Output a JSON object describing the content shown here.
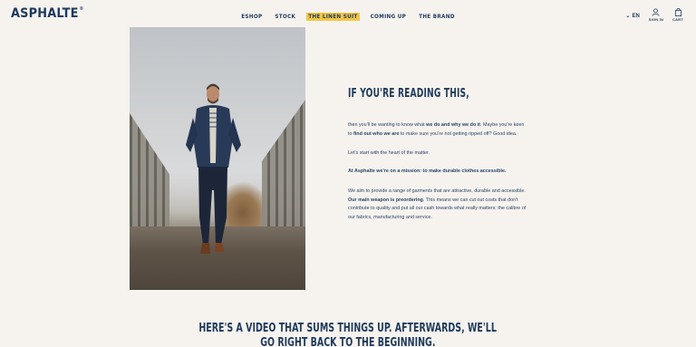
{
  "header": {
    "logo": "ASPHALTE",
    "logo_mark": "®",
    "nav": [
      "ESHOP",
      "STOCK",
      "THE LINEN SUIT",
      "COMING UP",
      "THE BRAND"
    ],
    "highlighted_nav_index": 2,
    "language": "EN",
    "sign_in": "SIGN IN",
    "cart": "CART",
    "accent_color": "#f2c744"
  },
  "main": {
    "heading": "IF YOU'RE READING THIS,",
    "p1_a": "then you'll be wanting to know what ",
    "p1_b": "we do and why we do it",
    "p1_c": ". Maybe you're keen to ",
    "p1_d": "find out who we are",
    "p1_e": " to make sure you're not getting ripped off? Good idea.",
    "p2": "Let's start with the heart of the matter.",
    "p3": "At Asphalte we're on a mission: to make durable clothes accessible.",
    "p4_a": "We aim to provide a range of garments that are attractive, durable and accessible. ",
    "p4_b": "Our main weapon is preordering",
    "p4_c": ". This means we can cut out costs that don't contribute to quality and put all our cash towards what really matters: the calibre of our fabrics, manufacturing and service."
  },
  "bottom": {
    "line1": "HERE'S A VIDEO THAT SUMS THINGS UP. AFTERWARDS, WE'LL",
    "line2": "GO RIGHT BACK TO THE BEGINNING."
  }
}
